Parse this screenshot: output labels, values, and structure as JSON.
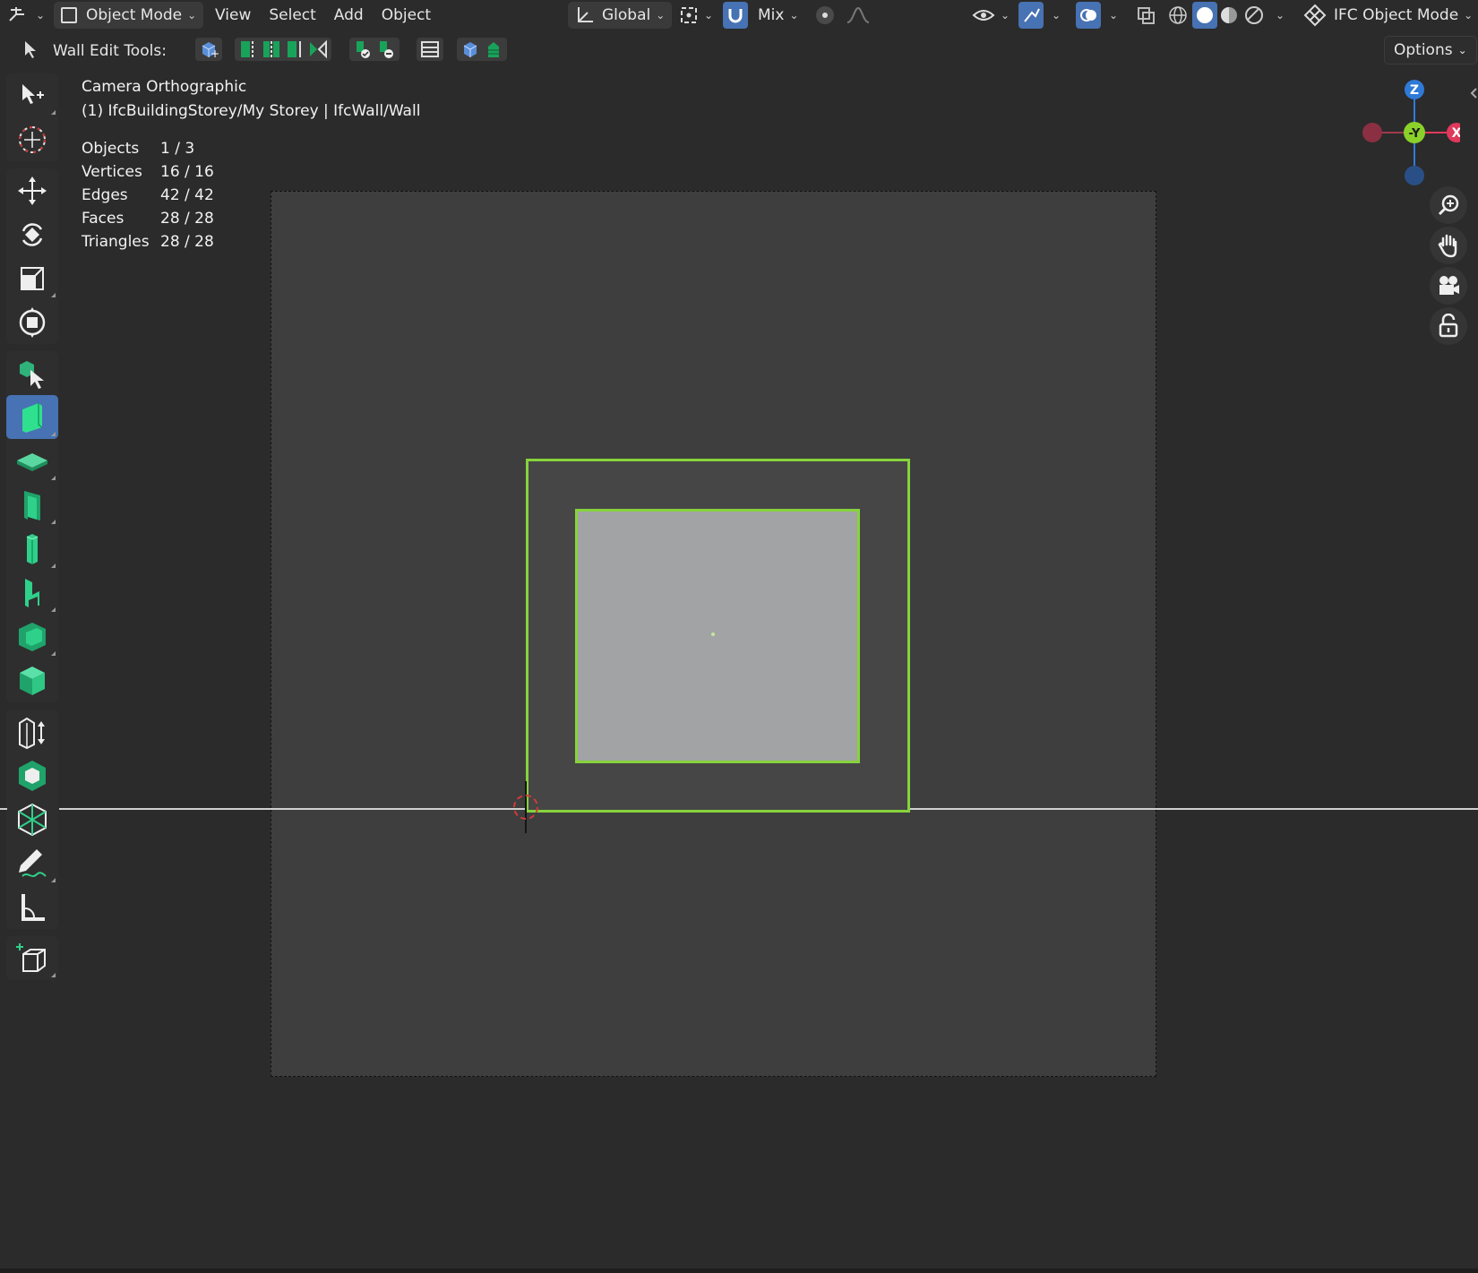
{
  "header": {
    "mode": "Object Mode",
    "menus": [
      "View",
      "Select",
      "Add",
      "Object"
    ],
    "orientation": "Global",
    "snap_mode": "Mix",
    "ifc_mode": "IFC Object Mode",
    "options_label": "Options"
  },
  "wall_tools": {
    "label": "Wall Edit Tools:"
  },
  "viewport": {
    "view_name": "Camera Orthographic",
    "context": "(1) IfcBuildingStorey/My Storey | IfcWall/Wall",
    "stats": [
      {
        "label": "Objects",
        "value": "1 / 3"
      },
      {
        "label": "Vertices",
        "value": "16 / 16"
      },
      {
        "label": "Edges",
        "value": "42 / 42"
      },
      {
        "label": "Faces",
        "value": "28 / 28"
      },
      {
        "label": "Triangles",
        "value": "28 / 28"
      }
    ]
  },
  "gizmo": {
    "z_label": "Z",
    "y_label": "-Y",
    "x_label": "X"
  },
  "colors": {
    "selection": "#86d33c",
    "accent": "#4772b3",
    "axis_x": "#e0395b",
    "axis_y": "#8ad12a",
    "axis_z": "#2f7ad8"
  }
}
